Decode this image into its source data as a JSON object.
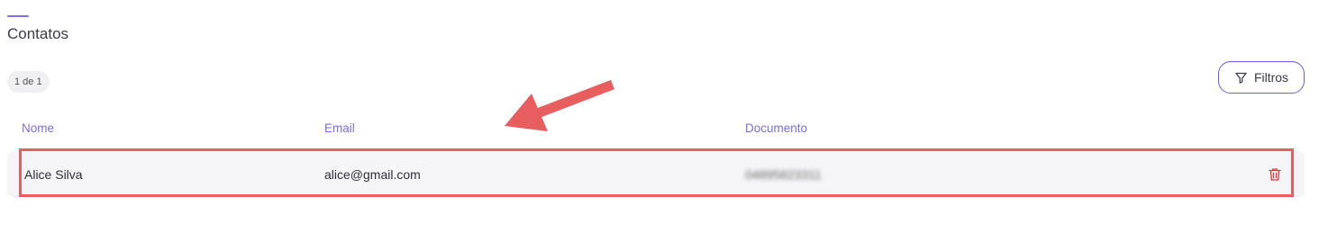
{
  "page": {
    "title": "Contatos"
  },
  "pagination": {
    "label": "1 de 1"
  },
  "toolbar": {
    "filters_label": "Filtros",
    "filters_icon": "funnel-icon"
  },
  "table": {
    "columns": [
      "Nome",
      "Email",
      "Documento"
    ],
    "rows": [
      {
        "name": "Alice Silva",
        "email": "alice@gmail.com",
        "document": "04895823311",
        "action_icon": "trash-icon"
      }
    ]
  },
  "colors": {
    "accent": "#6b5ce7",
    "header_text": "#7a6ee8",
    "annotation": "#e85d5d",
    "delete": "#d93a3a",
    "row_background": "#f5f5f7"
  }
}
